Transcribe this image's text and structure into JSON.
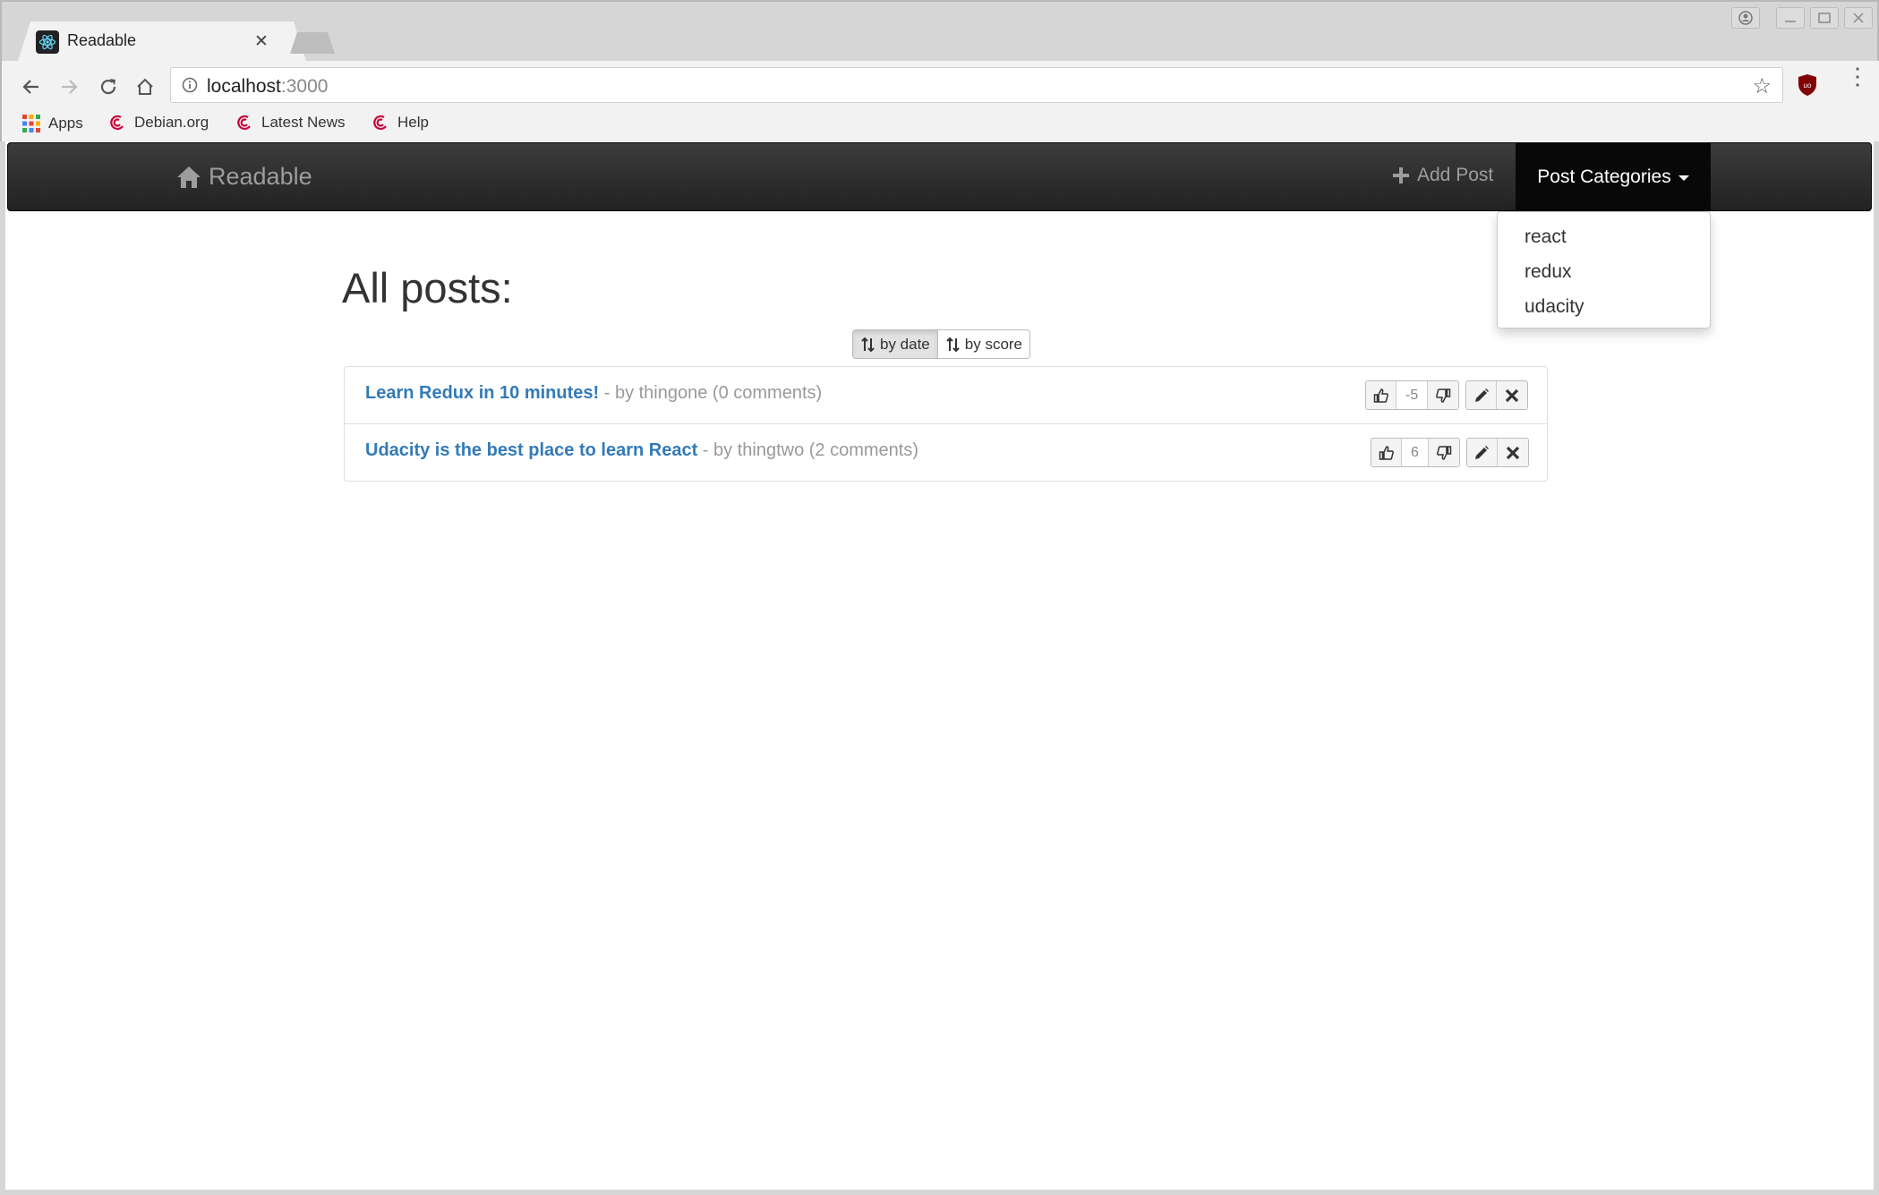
{
  "browser": {
    "tab_title": "Readable",
    "url_host": "localhost",
    "url_port": ":3000",
    "bookmarks": [
      {
        "label": "Apps",
        "icon": "apps-grid-icon"
      },
      {
        "label": "Debian.org",
        "icon": "debian-icon"
      },
      {
        "label": "Latest News",
        "icon": "debian-icon"
      },
      {
        "label": "Help",
        "icon": "debian-icon"
      }
    ]
  },
  "navbar": {
    "brand": "Readable",
    "add_post": "Add Post",
    "categories_label": "Post Categories",
    "categories": [
      "react",
      "redux",
      "udacity"
    ]
  },
  "main": {
    "heading": "All posts:",
    "sort": {
      "by_date": "by date",
      "by_score": "by score"
    },
    "posts": [
      {
        "title": "Learn Redux in 10 minutes!",
        "meta": " - by thingone (0 comments)",
        "score": "-5"
      },
      {
        "title": "Udacity is the best place to learn React",
        "meta": " - by thingtwo (2 comments)",
        "score": "6"
      }
    ]
  },
  "colors": {
    "link": "#337ab7",
    "navbar": "#222222",
    "muted": "#999999"
  }
}
